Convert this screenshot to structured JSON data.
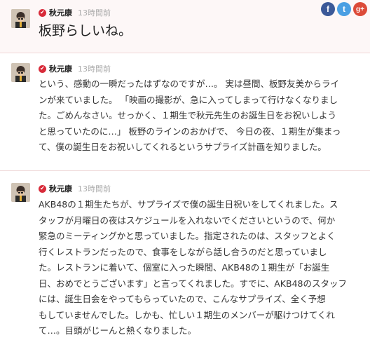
{
  "posts": [
    {
      "author": "秋元康",
      "time": "13時間前",
      "body": "板野らしいね。"
    },
    {
      "author": "秋元康",
      "time": "13時間前",
      "body": "という、感動の一瞬だったはずなのですが…。 実は昼間、板野友美からライ\nンが来ていました。 「映画の撮影が、急に入ってしまって行けなくなりまし\nた。ごめんなさい。せっかく、１期生で秋元先生のお誕生日をお祝いしよう\nと思っていたのに…」 板野のラインのおかげで、 今日の夜、１期生が集まっ\nて、僕の誕生日をお祝いしてくれるというサプライズ計画を知りました。"
    },
    {
      "author": "秋元康",
      "time": "13時間前",
      "body": "AKB48の１期生たちが、サプライズで僕の誕生日祝いをしてくれました。ス\nタッフが月曜日の夜はスケジュールを入れないでくださいというので、何か\n緊急のミーティングかと思っていました。指定されたのは、スタッフとよく\n行くレストランだったので、食事をしながら話し合うのだと思っていまし\nた。レストランに着いて、個室に入った瞬間、AKB48の１期生が「お誕生\n日、おめでとうございます」と言ってくれました。すでに、AKB48のスタッフ\nには、誕生日会をやってもらっていたので、こんなサプライズ、全く予想\nもしていませんでした。しかも、忙しい１期生のメンバーが駆けつけてくれ\nて…。目頭がじーんと熱くなりました。"
    }
  ],
  "social": {
    "facebook": "f",
    "twitter": "t",
    "googleplus": "g+"
  },
  "colors": {
    "badge": "#d82b3a",
    "facebook": "#3b5998",
    "twitter": "#4a9fe3",
    "googleplus": "#dc4a38"
  }
}
